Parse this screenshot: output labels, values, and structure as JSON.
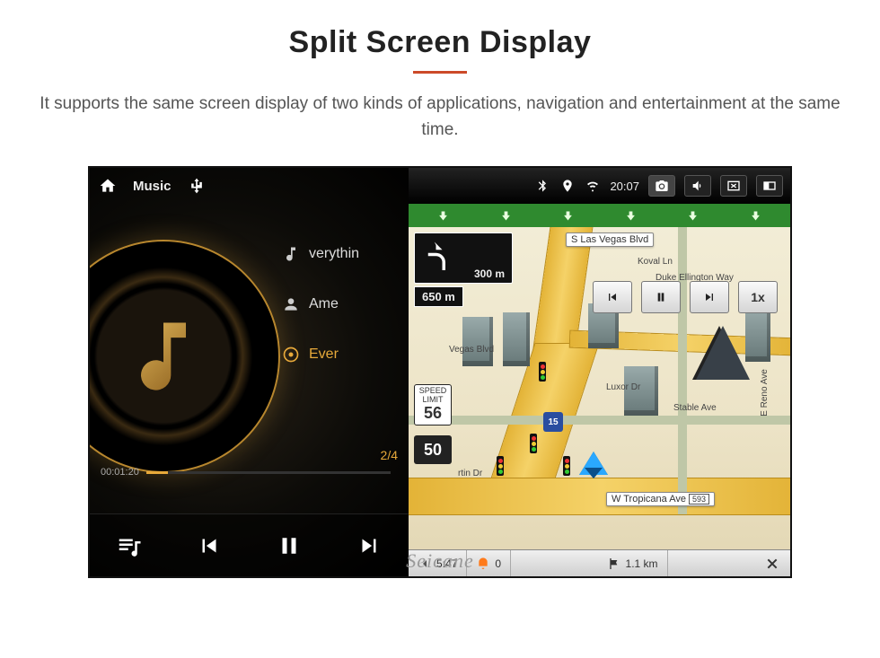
{
  "page": {
    "title": "Split Screen Display",
    "description": "It supports the same screen display of two kinds of applications, navigation and entertainment at the same time."
  },
  "status_bar": {
    "time": "20:07"
  },
  "music": {
    "header_label": "Music",
    "tracks": [
      {
        "label": "verythin"
      },
      {
        "label": "Ame"
      },
      {
        "label": "Ever"
      }
    ],
    "counter": "2/4",
    "time_elapsed": "00:01:20",
    "time_total": ""
  },
  "nav": {
    "turn": {
      "main_dist": "300 m",
      "sub_dist": "650 m"
    },
    "sim": {
      "speed_label": "1x"
    },
    "speed_sign": {
      "label": "SPEED LIMIT",
      "value": "56"
    },
    "shield50": "50",
    "shield15": "15",
    "streets": {
      "top": "S Las Vegas Blvd",
      "koval": "Koval Ln",
      "duke": "Duke Ellington Way",
      "vegas_blvd_w": "Vegas Blvd",
      "luxor": "Luxor Dr",
      "stable": "Stable Ave",
      "reno": "E Reno Ave",
      "martin": "rtin Dr",
      "tropicana": "W Tropicana Ave",
      "tropicana_num": "593"
    },
    "bottom": {
      "back_time": "5:47",
      "alert": "0",
      "dest_dist": "1.1 km"
    }
  },
  "watermark": "Seicane"
}
